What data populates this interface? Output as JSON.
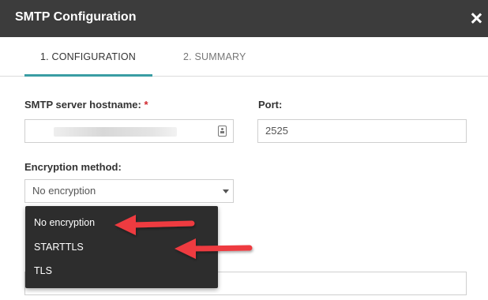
{
  "dialog": {
    "title": "SMTP Configuration"
  },
  "tabs": [
    {
      "label": "1. CONFIGURATION",
      "active": true
    },
    {
      "label": "2. SUMMARY",
      "active": false
    }
  ],
  "form": {
    "hostname": {
      "label": "SMTP server hostname:",
      "required_mark": "*",
      "value": ""
    },
    "port": {
      "label": "Port:",
      "value": "2525"
    },
    "encryption": {
      "label": "Encryption method:",
      "selected": "No encryption",
      "options": [
        "No encryption",
        "STARTTLS",
        "TLS"
      ]
    }
  },
  "colors": {
    "titlebar": "#3c3c3c",
    "tab_accent": "#3a9da3",
    "required": "#d0272d",
    "dropdown_bg": "#2d2d2d",
    "annotation_arrow": "#ee3a3f"
  }
}
